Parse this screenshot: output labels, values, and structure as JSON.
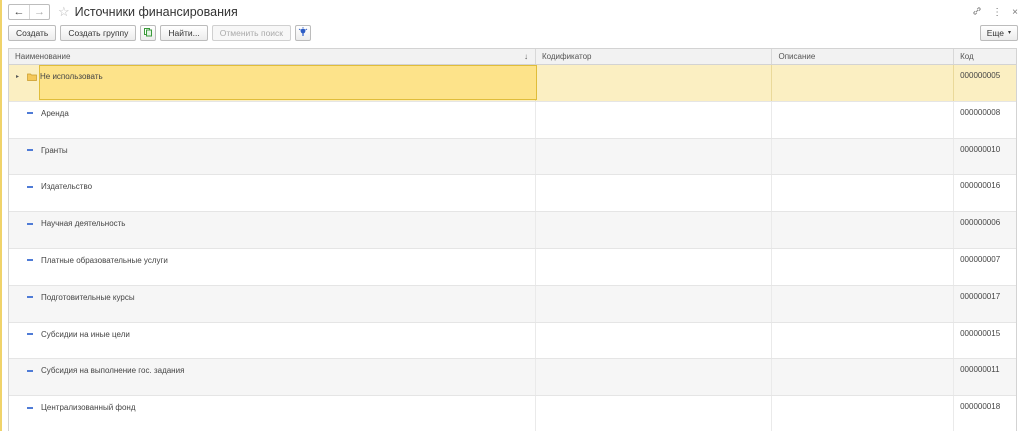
{
  "window": {
    "title": "Источники финансирования",
    "back_icon": "←",
    "forward_icon": "→",
    "star_icon": "☆",
    "link_icon": "🔗",
    "menu_icon": "⋮",
    "close_icon": "×"
  },
  "toolbar": {
    "create": "Создать",
    "create_group": "Создать группу",
    "find": "Найти...",
    "cancel_search": "Отменить поиск",
    "more": "Еще",
    "more_caret": "▾"
  },
  "table": {
    "columns": {
      "name": "Наименование",
      "sort_arrow": "↓",
      "codifier": "Кодификатор",
      "description": "Описание",
      "code": "Код"
    },
    "expand_icon": "▸",
    "rows": [
      {
        "name": "Не использовать",
        "code": "000000005",
        "kind": "group"
      },
      {
        "name": "Аренда",
        "code": "000000008",
        "kind": "item"
      },
      {
        "name": "Гранты",
        "code": "000000010",
        "kind": "item"
      },
      {
        "name": "Издательство",
        "code": "000000016",
        "kind": "item"
      },
      {
        "name": "Научная деятельность",
        "code": "000000006",
        "kind": "item"
      },
      {
        "name": "Платные образовательные услуги",
        "code": "000000007",
        "kind": "item"
      },
      {
        "name": "Подготовительные курсы",
        "code": "000000017",
        "kind": "item"
      },
      {
        "name": "Субсидии на иные цели",
        "code": "000000015",
        "kind": "item"
      },
      {
        "name": "Субсидия на выполнение гос. задания",
        "code": "000000011",
        "kind": "item"
      },
      {
        "name": "Централизованный фонд",
        "code": "000000018",
        "kind": "item"
      }
    ]
  },
  "colors": {
    "selected_row": "#fbefc2",
    "selected_cell": "#fde38a",
    "accent": "#f0d36a",
    "item_marker": "#4f7bd6"
  }
}
